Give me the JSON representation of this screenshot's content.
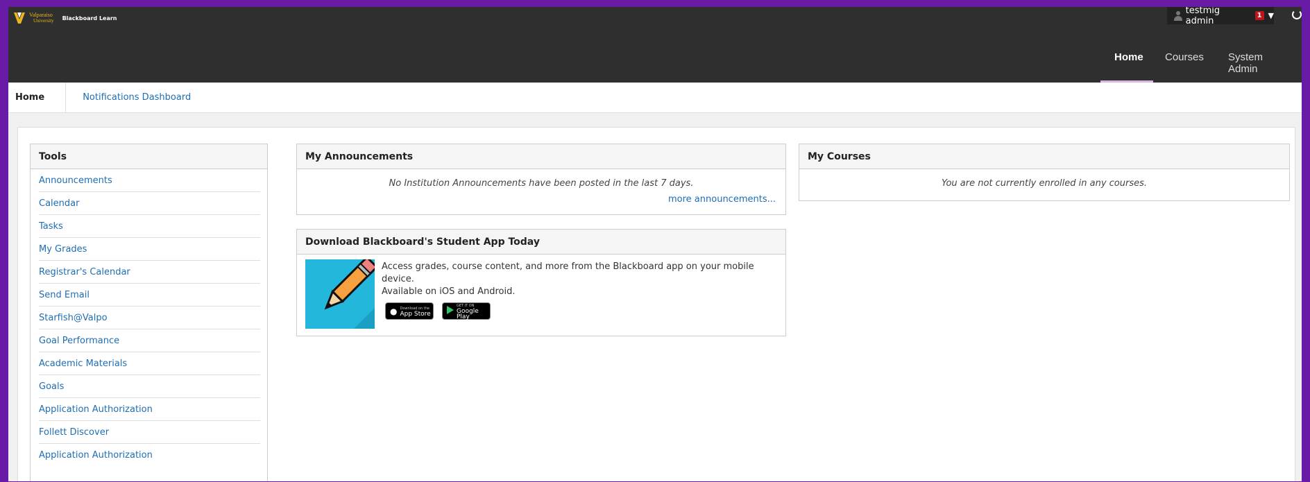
{
  "header": {
    "logo_line1": "Valparaiso",
    "logo_line2": "University",
    "product": "Blackboard Learn",
    "user_name": "testmig admin",
    "notification_count": "1",
    "nav": [
      {
        "label": "Home",
        "active": true
      },
      {
        "label": "Courses",
        "active": false
      },
      {
        "label": "System Admin",
        "active": false
      }
    ]
  },
  "subtabs": {
    "home": "Home",
    "notifications": "Notifications Dashboard"
  },
  "tools": {
    "title": "Tools",
    "items": [
      "Announcements",
      "Calendar",
      "Tasks",
      "My Grades",
      "Registrar's Calendar",
      "Send Email",
      "Starfish@Valpo",
      "Goal Performance",
      "Academic Materials",
      "Goals",
      "Application Authorization",
      "Follett Discover",
      "Application Authorization"
    ]
  },
  "announcements": {
    "title": "My Announcements",
    "message": "No Institution Announcements have been posted in the last 7 days.",
    "more": "more announcements..."
  },
  "app_promo": {
    "title": "Download Blackboard's Student App Today",
    "line1": "Access grades, course content, and more from the Blackboard app on your mobile device.",
    "line2": "Available on iOS and Android.",
    "appstore_small": "Download on the",
    "appstore_big": "App Store",
    "googleplay_small": "GET IT ON",
    "googleplay_big": "Google Play"
  },
  "courses": {
    "title": "My Courses",
    "message": "You are not currently enrolled in any courses."
  },
  "colors": {
    "header_bg": "#2f2f2f",
    "link": "#1f6db3",
    "frame": "#6a1ba6",
    "badge": "#c0141c"
  }
}
